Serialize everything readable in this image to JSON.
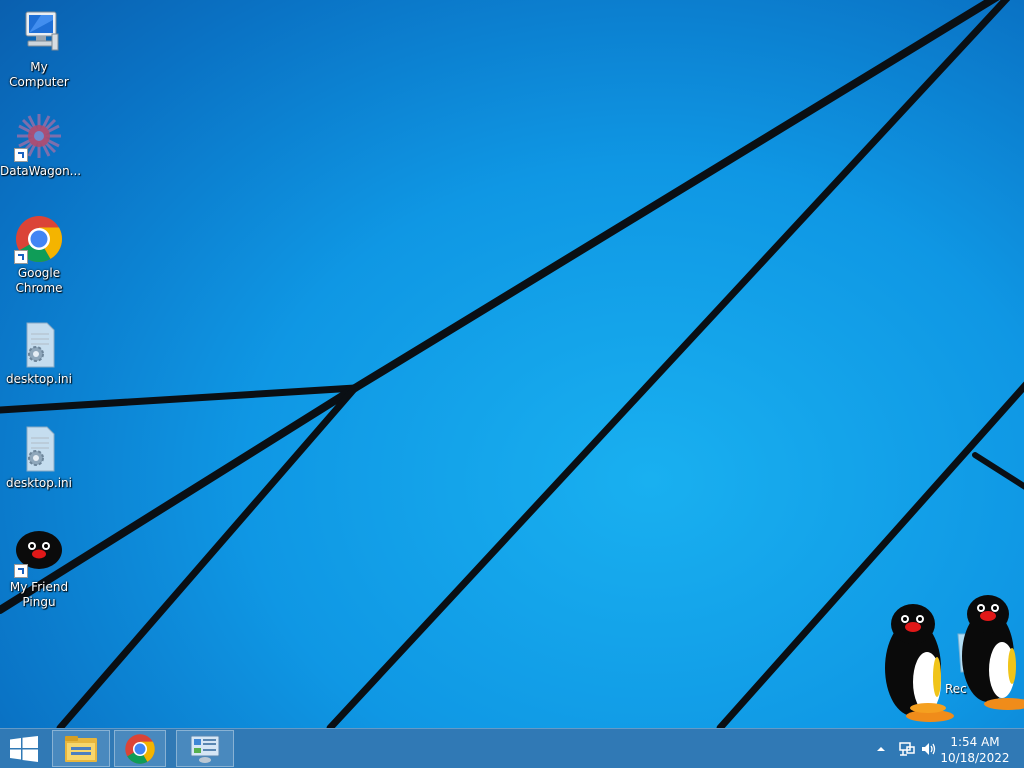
{
  "desktop": {
    "icons": [
      {
        "label": "My Computer"
      },
      {
        "label": "DataWagon..."
      },
      {
        "label": "Google Chrome"
      },
      {
        "label": "desktop.ini"
      },
      {
        "label": "desktop.ini"
      },
      {
        "label": "My Friend Pingu"
      }
    ],
    "recycle_bin_label": "Rec"
  },
  "taskbar": {
    "start_icon": "windows-logo-icon",
    "pinned": [
      "file-explorer-icon",
      "chrome-icon",
      "control-panel-icon"
    ],
    "clock": {
      "time": "1:54 AM",
      "date": "10/18/2022"
    }
  },
  "colors": {
    "wallpaper": "#0f97e4",
    "taskbar": "#1e6eaf"
  }
}
